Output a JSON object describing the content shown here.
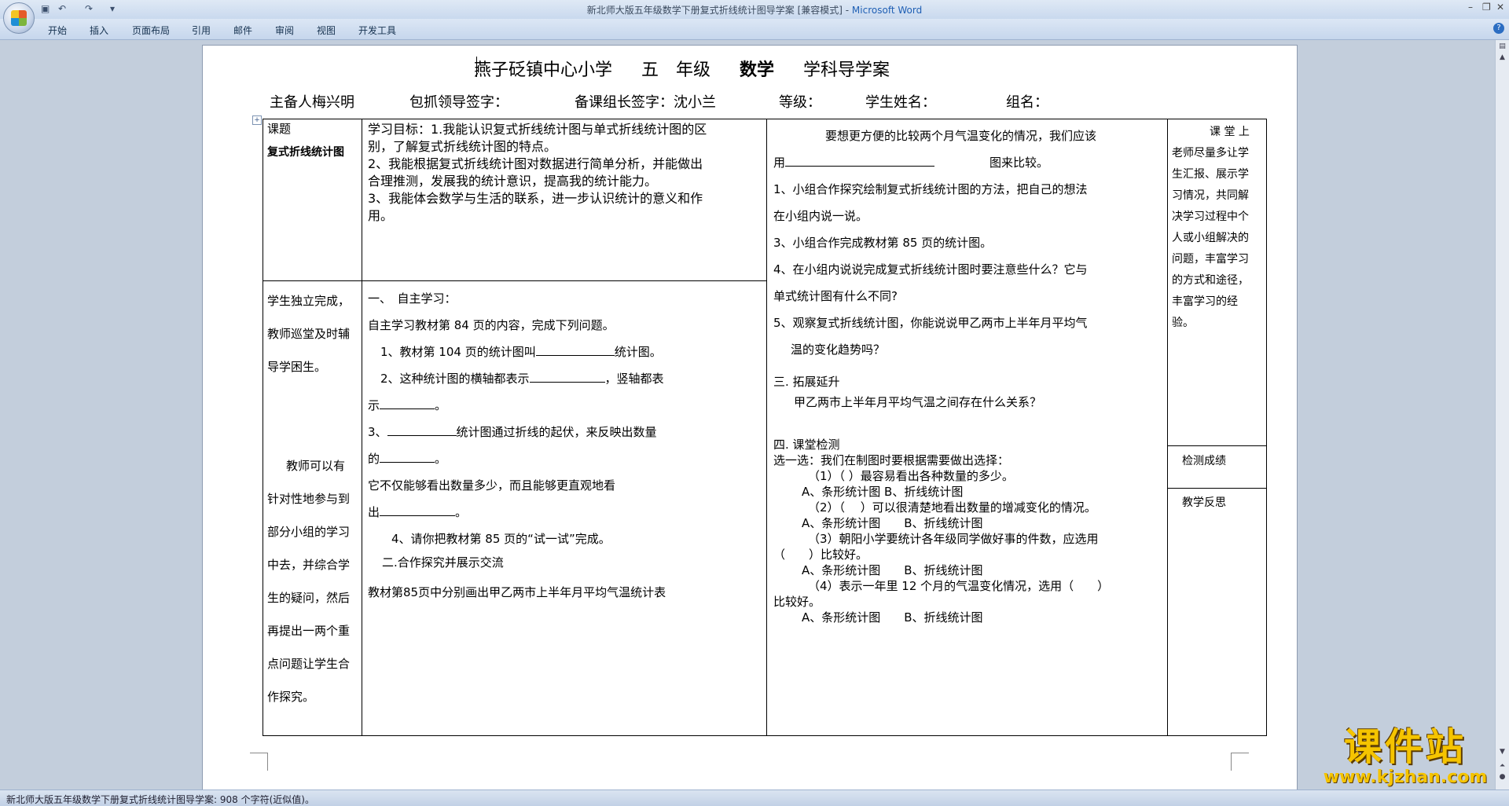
{
  "window": {
    "title": "新北师大版五年级数学下册复式折线统计图导学案 [兼容模式] - ",
    "app_name": "Microsoft Word",
    "qat": [
      "save-icon",
      "undo-icon",
      "redo-icon",
      "customize-icon"
    ]
  },
  "ribbon": {
    "tabs": [
      "开始",
      "插入",
      "页面布局",
      "引用",
      "邮件",
      "审阅",
      "视图",
      "开发工具"
    ]
  },
  "doc": {
    "title_parts": [
      "燕子砭镇中心小学",
      "五　年级",
      "数学",
      "学科导学案"
    ],
    "info": {
      "author": "主备人梅兴明",
      "leader_sign": "包抓领导签字：",
      "group_leader": "备课组长签字：沈小兰",
      "grade": "等级：",
      "student": "学生姓名：",
      "group": "组名："
    },
    "col1": {
      "topic_label": "课题",
      "topic": "复式折线统计图",
      "p1": "学生独立完成，",
      "p2": "教师巡堂及时辅",
      "p3": "导学困生。",
      "t1": "教师可以有",
      "t2": "针对性地参与到",
      "t3": "部分小组的学习",
      "t4": "中去，并综合学",
      "t5": "生的疑问，然后",
      "t6": "再提出一两个重",
      "t7": "点问题让学生合",
      "t8": "作探究。"
    },
    "col2": {
      "obj1": "学习目标：1.我能认识复式折线统计图与单式折线统计图的区",
      "obj1b": "别，了解复式折线统计图的特点。",
      "obj2": "2、我能根据复式折线统计图对数据进行简单分析，并能做出",
      "obj2b": "合理推测，发展我的统计意识，提高我的统计能力。",
      "obj3": "3、我能体会数学与生活的联系，进一步认识统计的意义和作",
      "obj3b": "用。",
      "s1": "一、　自主学习：",
      "s1a": "自主学习教材第 84 页的内容，完成下列问题。",
      "q1a": "1、教材第 104 页的统计图叫",
      "q1b": "统计图。",
      "q2a": "2、这种统计图的横轴都表示",
      "q2b": "，竖轴都表",
      "q2c": "示",
      "q2d": "。",
      "q3a": "3、",
      "q3b": "统计图通过折线的起伏，来反映出数量",
      "q3c": "的",
      "q3d": "。",
      "q3e": "它不仅能够看出数量多少，而且能够更直观地看",
      "q3f": "出",
      "q3g": "。",
      "q4": "4、请你把教材第 85 页的“试一试”完成。",
      "s2": "二.合作探究并展示交流",
      "s2a": "教材第85页中分别画出甲乙两市上半年月平均气温统计表"
    },
    "col3": {
      "intro1": "要想更方便的比较两个月气温变化的情况，我们应该",
      "intro2a": "用",
      "intro2b": "图来比较。",
      "c1a": "1、小组合作探究绘制复式折线统计图的方法，把自己的想法",
      "c1b": "在小组内说一说。",
      "c3": "3、小组合作完成教材第 85 页的统计图。",
      "c4a": "4、在小组内说说完成复式折线统计图时要注意些什么？它与",
      "c4b": "单式统计图有什么不同?",
      "c5a": "5、观察复式折线统计图，你能说说甲乙两市上半年月平均气",
      "c5b": "温的变化趋势吗？",
      "ext": "三. 拓展延升",
      "ext_q": "甲乙两市上半年月平均气温之间存在什么关系？",
      "test": "四. 课堂检测",
      "choose": "选一选：我们在制图时要根据需要做出选择：",
      "t1": "（1）（ ）最容易看出各种数量的多少。",
      "t1o": "A、条形统计图 B、折线统计图",
      "t2": "（2）（　 ）可以很清楚地看出数量的增减变化的情况。",
      "t2o": "A、条形统计图　　B、折线统计图",
      "t3": "（3）朝阳小学要统计各年级同学做好事的件数，应选用",
      "t3b": "（　　）比较好。",
      "t3o": "A、条形统计图　　B、折线统计图",
      "t4": "（4）表示一年里 12 个月的气温变化情况，选用（　　）",
      "t4b": "比较好。",
      "t4o": "A、条形统计图　　B、折线统计图"
    },
    "col4": {
      "note1": "课 堂 上",
      "note2": "老师尽量多让学",
      "note3": "生汇报、展示学",
      "note4": "习情况，共同解",
      "note5": "决学习过程中个",
      "note6": "人或小组解决的",
      "note7": "问题，丰富学习",
      "note8": "的方式和途径，",
      "note9": "丰富学习的经",
      "note10": "验。",
      "test_score": "检测成绩",
      "reflection": "教学反思"
    }
  },
  "status": {
    "text": "新北师大版五年级数学下册复式折线统计图导学案: 908 个字符(近似值)。"
  },
  "watermark": {
    "main": "课件站",
    "url": "www.kjzhan.com"
  }
}
